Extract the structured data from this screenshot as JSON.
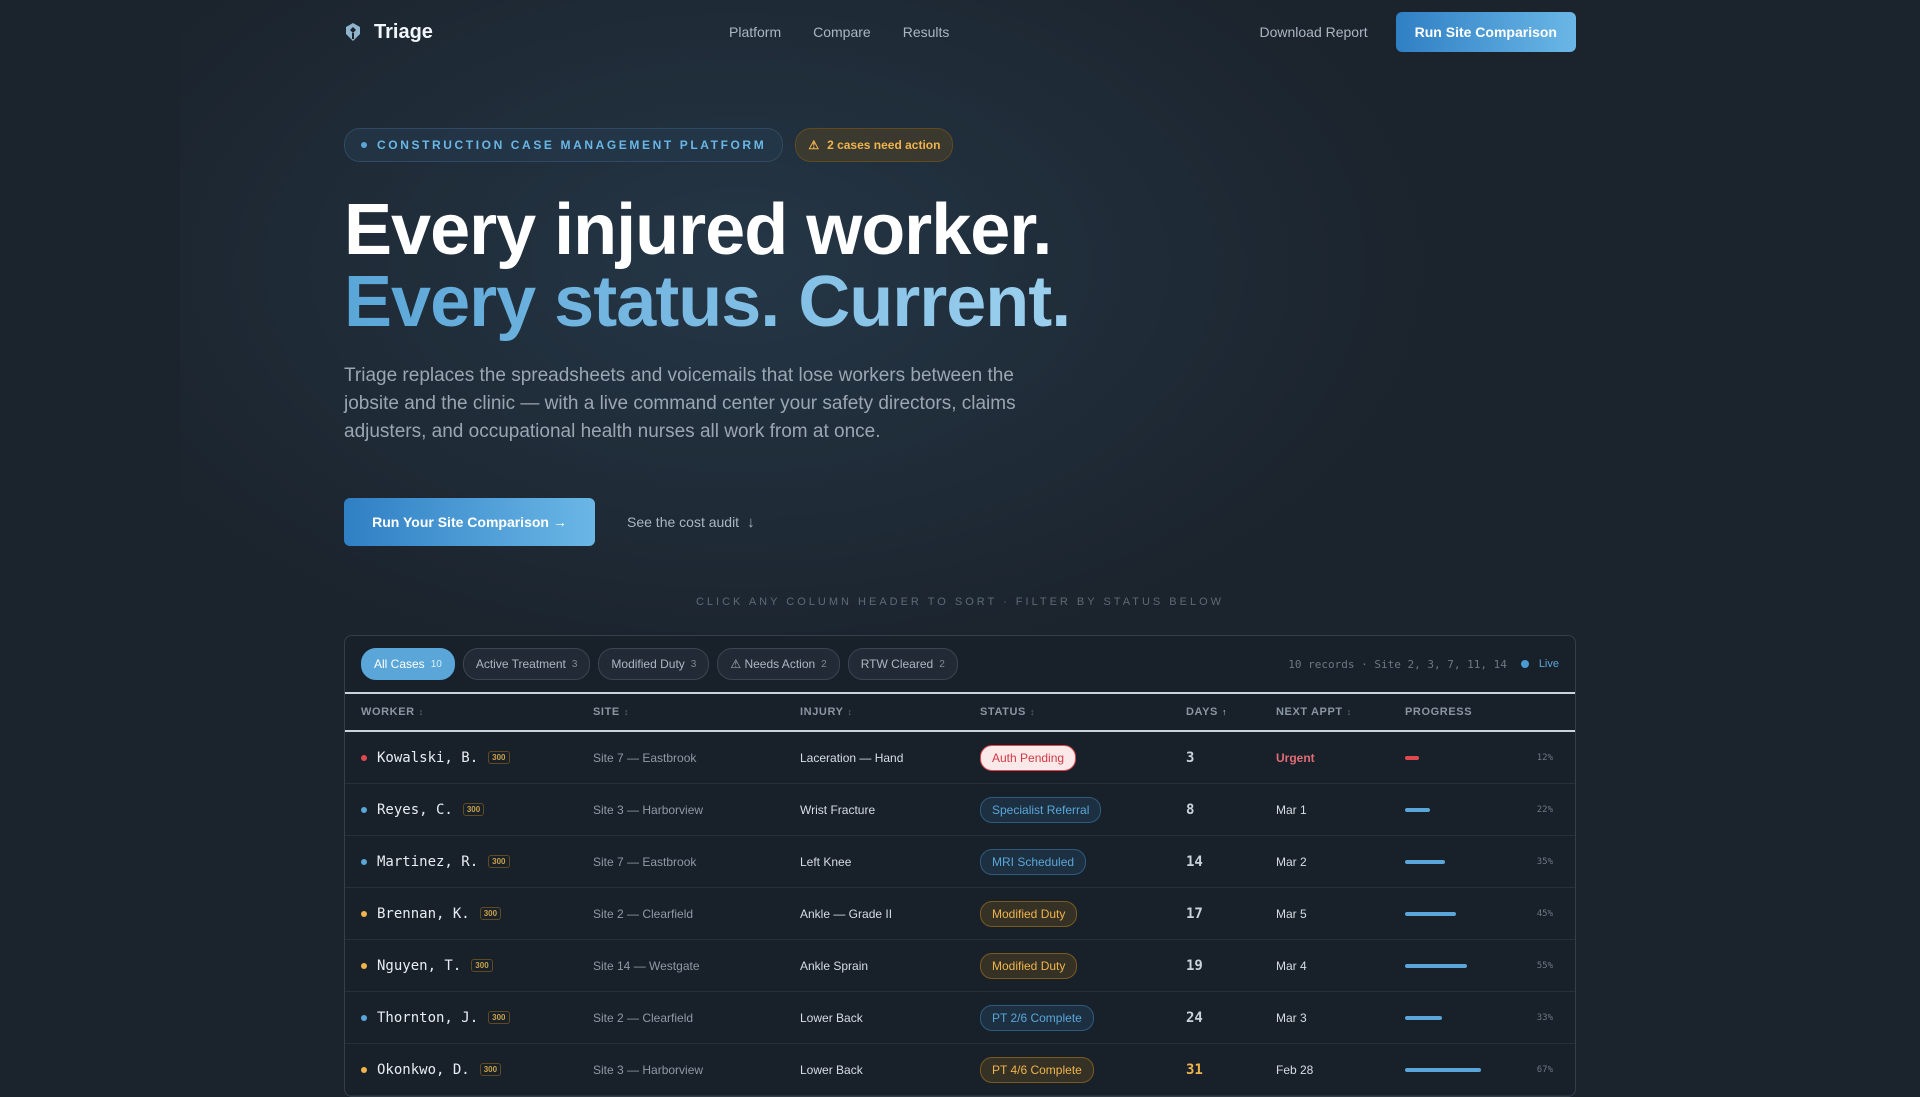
{
  "nav": {
    "brand": "Triage",
    "links": [
      "Platform",
      "Compare",
      "Results"
    ],
    "download": "Download Report",
    "cta": "Run Site Comparison"
  },
  "hero": {
    "eyebrow": "CONSTRUCTION CASE MANAGEMENT PLATFORM",
    "alert": "2 cases need action",
    "headline_1": "Every injured worker.",
    "headline_2": "Every status. Current.",
    "lede": "Triage replaces the spreadsheets and voicemails that lose workers between the jobsite and the clinic — with a live command center your safety directors, claims adjusters, and occupational health nurses all work from at once.",
    "cta_primary": "Run Your Site Comparison →",
    "cta_secondary": "See the cost audit",
    "hint": "CLICK ANY COLUMN HEADER TO SORT · FILTER BY STATUS BELOW"
  },
  "filters": [
    {
      "label": "All Cases",
      "count": "10",
      "active": true
    },
    {
      "label": "Active Treatment",
      "count": "3",
      "active": false
    },
    {
      "label": "Modified Duty",
      "count": "3",
      "active": false
    },
    {
      "label": "⚠ Needs Action",
      "count": "2",
      "active": false
    },
    {
      "label": "RTW Cleared",
      "count": "2",
      "active": false
    }
  ],
  "meta": {
    "records": "10 records · Site 2, 3, 7, 11, 14",
    "live": "Live"
  },
  "columns": [
    "WORKER",
    "SITE",
    "INJURY",
    "STATUS",
    "DAYS",
    "NEXT APPT",
    "PROGRESS"
  ],
  "colors": {
    "red": "#e0474f",
    "blue": "#5aa6d8",
    "amber": "#f0b44c"
  },
  "rows": [
    {
      "worker": "Kowalski, B.",
      "tag": "300",
      "site": "Site 7 — Eastbrook",
      "injury": "Laceration — Hand",
      "status": "Auth Pending",
      "tone": "red",
      "days": "3",
      "appt": "Urgent",
      "progress": 12,
      "pct": "12%"
    },
    {
      "worker": "Reyes, C.",
      "tag": "300",
      "site": "Site 3 — Harborview",
      "injury": "Wrist Fracture",
      "status": "Specialist Referral",
      "tone": "blue",
      "days": "8",
      "appt": "Mar 1",
      "progress": 22,
      "pct": "22%"
    },
    {
      "worker": "Martinez, R.",
      "tag": "300",
      "site": "Site 7 — Eastbrook",
      "injury": "Left Knee",
      "status": "MRI Scheduled",
      "tone": "blue",
      "days": "14",
      "appt": "Mar 2",
      "progress": 35,
      "pct": "35%"
    },
    {
      "worker": "Brennan, K.",
      "tag": "300",
      "site": "Site 2 — Clearfield",
      "injury": "Ankle — Grade II",
      "status": "Modified Duty",
      "tone": "amber",
      "days": "17",
      "appt": "Mar 5",
      "progress": 45,
      "pct": "45%"
    },
    {
      "worker": "Nguyen, T.",
      "tag": "300",
      "site": "Site 14 — Westgate",
      "injury": "Ankle Sprain",
      "status": "Modified Duty",
      "tone": "amber",
      "days": "19",
      "appt": "Mar 4",
      "progress": 55,
      "pct": "55%"
    },
    {
      "worker": "Thornton, J.",
      "tag": "300",
      "site": "Site 2 — Clearfield",
      "injury": "Lower Back",
      "status": "PT 2/6 Complete",
      "tone": "blue",
      "days": "24",
      "appt": "Mar 3",
      "progress": 33,
      "pct": "33%"
    },
    {
      "worker": "Okonkwo, D.",
      "tag": "300",
      "site": "Site 3 — Harborview",
      "injury": "Lower Back",
      "status": "PT 4/6 Complete",
      "tone": "amber",
      "days": "31",
      "appt": "Feb 28",
      "progress": 67,
      "pct": "67%"
    }
  ]
}
